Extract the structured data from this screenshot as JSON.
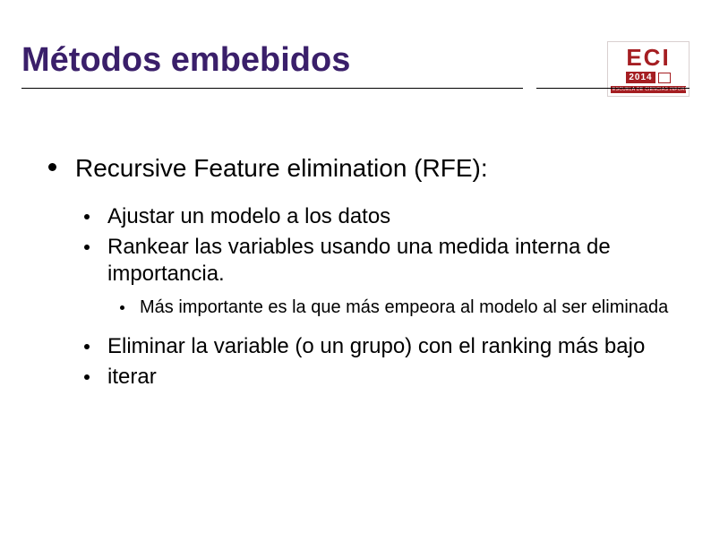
{
  "logo": {
    "abbr": "ECI",
    "year": "2014",
    "subtitle": "ESCUELA DE CIENCIAS INFORMATICAS"
  },
  "title": "Métodos embebidos",
  "list": {
    "item1": "Recursive Feature elimination (RFE):",
    "sub": {
      "a": "Ajustar un modelo a los datos",
      "b": "Rankear las variables usando una medida interna de importancia.",
      "b_sub": "Más importante es la que más empeora al modelo al ser eliminada",
      "c": "Eliminar la variable (o un grupo) con el ranking más bajo",
      "d": "iterar"
    }
  }
}
